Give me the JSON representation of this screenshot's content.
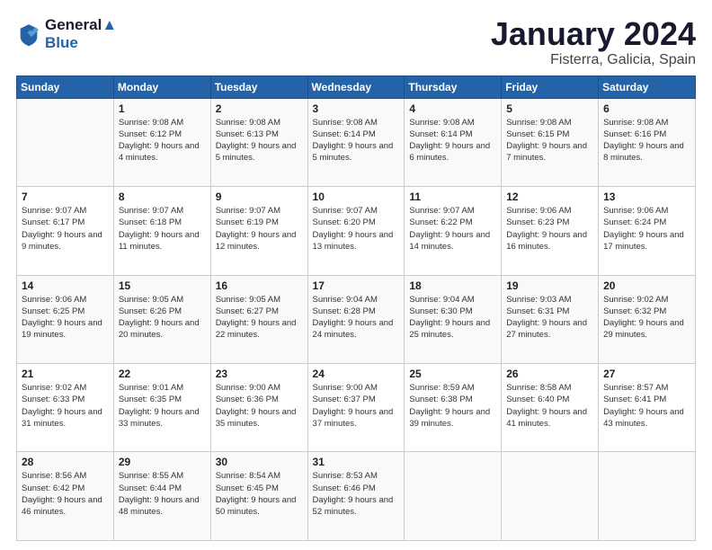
{
  "logo": {
    "line1": "General",
    "line2": "Blue"
  },
  "title": "January 2024",
  "subtitle": "Fisterra, Galicia, Spain",
  "headers": [
    "Sunday",
    "Monday",
    "Tuesday",
    "Wednesday",
    "Thursday",
    "Friday",
    "Saturday"
  ],
  "weeks": [
    [
      {
        "day": "",
        "sunrise": "",
        "sunset": "",
        "daylight": ""
      },
      {
        "day": "1",
        "sunrise": "9:08 AM",
        "sunset": "6:12 PM",
        "daylight": "9 hours and 4 minutes."
      },
      {
        "day": "2",
        "sunrise": "9:08 AM",
        "sunset": "6:13 PM",
        "daylight": "9 hours and 5 minutes."
      },
      {
        "day": "3",
        "sunrise": "9:08 AM",
        "sunset": "6:14 PM",
        "daylight": "9 hours and 5 minutes."
      },
      {
        "day": "4",
        "sunrise": "9:08 AM",
        "sunset": "6:14 PM",
        "daylight": "9 hours and 6 minutes."
      },
      {
        "day": "5",
        "sunrise": "9:08 AM",
        "sunset": "6:15 PM",
        "daylight": "9 hours and 7 minutes."
      },
      {
        "day": "6",
        "sunrise": "9:08 AM",
        "sunset": "6:16 PM",
        "daylight": "9 hours and 8 minutes."
      }
    ],
    [
      {
        "day": "7",
        "sunrise": "9:07 AM",
        "sunset": "6:17 PM",
        "daylight": "9 hours and 9 minutes."
      },
      {
        "day": "8",
        "sunrise": "9:07 AM",
        "sunset": "6:18 PM",
        "daylight": "9 hours and 11 minutes."
      },
      {
        "day": "9",
        "sunrise": "9:07 AM",
        "sunset": "6:19 PM",
        "daylight": "9 hours and 12 minutes."
      },
      {
        "day": "10",
        "sunrise": "9:07 AM",
        "sunset": "6:20 PM",
        "daylight": "9 hours and 13 minutes."
      },
      {
        "day": "11",
        "sunrise": "9:07 AM",
        "sunset": "6:22 PM",
        "daylight": "9 hours and 14 minutes."
      },
      {
        "day": "12",
        "sunrise": "9:06 AM",
        "sunset": "6:23 PM",
        "daylight": "9 hours and 16 minutes."
      },
      {
        "day": "13",
        "sunrise": "9:06 AM",
        "sunset": "6:24 PM",
        "daylight": "9 hours and 17 minutes."
      }
    ],
    [
      {
        "day": "14",
        "sunrise": "9:06 AM",
        "sunset": "6:25 PM",
        "daylight": "9 hours and 19 minutes."
      },
      {
        "day": "15",
        "sunrise": "9:05 AM",
        "sunset": "6:26 PM",
        "daylight": "9 hours and 20 minutes."
      },
      {
        "day": "16",
        "sunrise": "9:05 AM",
        "sunset": "6:27 PM",
        "daylight": "9 hours and 22 minutes."
      },
      {
        "day": "17",
        "sunrise": "9:04 AM",
        "sunset": "6:28 PM",
        "daylight": "9 hours and 24 minutes."
      },
      {
        "day": "18",
        "sunrise": "9:04 AM",
        "sunset": "6:30 PM",
        "daylight": "9 hours and 25 minutes."
      },
      {
        "day": "19",
        "sunrise": "9:03 AM",
        "sunset": "6:31 PM",
        "daylight": "9 hours and 27 minutes."
      },
      {
        "day": "20",
        "sunrise": "9:02 AM",
        "sunset": "6:32 PM",
        "daylight": "9 hours and 29 minutes."
      }
    ],
    [
      {
        "day": "21",
        "sunrise": "9:02 AM",
        "sunset": "6:33 PM",
        "daylight": "9 hours and 31 minutes."
      },
      {
        "day": "22",
        "sunrise": "9:01 AM",
        "sunset": "6:35 PM",
        "daylight": "9 hours and 33 minutes."
      },
      {
        "day": "23",
        "sunrise": "9:00 AM",
        "sunset": "6:36 PM",
        "daylight": "9 hours and 35 minutes."
      },
      {
        "day": "24",
        "sunrise": "9:00 AM",
        "sunset": "6:37 PM",
        "daylight": "9 hours and 37 minutes."
      },
      {
        "day": "25",
        "sunrise": "8:59 AM",
        "sunset": "6:38 PM",
        "daylight": "9 hours and 39 minutes."
      },
      {
        "day": "26",
        "sunrise": "8:58 AM",
        "sunset": "6:40 PM",
        "daylight": "9 hours and 41 minutes."
      },
      {
        "day": "27",
        "sunrise": "8:57 AM",
        "sunset": "6:41 PM",
        "daylight": "9 hours and 43 minutes."
      }
    ],
    [
      {
        "day": "28",
        "sunrise": "8:56 AM",
        "sunset": "6:42 PM",
        "daylight": "9 hours and 46 minutes."
      },
      {
        "day": "29",
        "sunrise": "8:55 AM",
        "sunset": "6:44 PM",
        "daylight": "9 hours and 48 minutes."
      },
      {
        "day": "30",
        "sunrise": "8:54 AM",
        "sunset": "6:45 PM",
        "daylight": "9 hours and 50 minutes."
      },
      {
        "day": "31",
        "sunrise": "8:53 AM",
        "sunset": "6:46 PM",
        "daylight": "9 hours and 52 minutes."
      },
      {
        "day": "",
        "sunrise": "",
        "sunset": "",
        "daylight": ""
      },
      {
        "day": "",
        "sunrise": "",
        "sunset": "",
        "daylight": ""
      },
      {
        "day": "",
        "sunrise": "",
        "sunset": "",
        "daylight": ""
      }
    ]
  ]
}
